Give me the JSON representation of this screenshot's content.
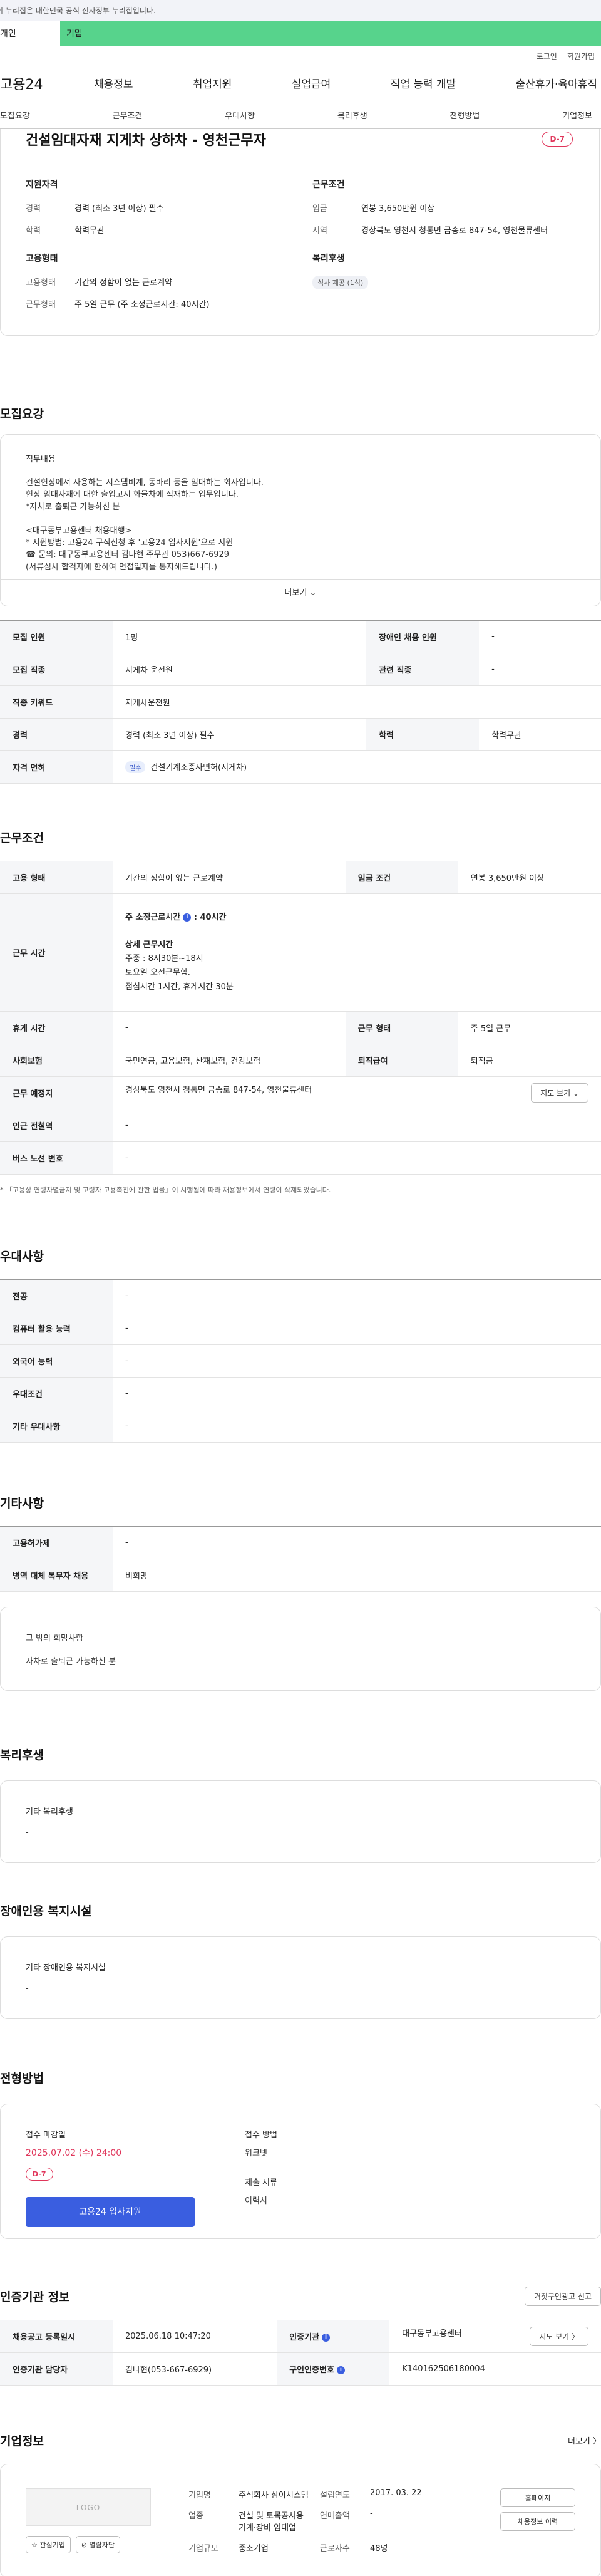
{
  "notice": "이 누리집은 대한민국 공식 전자정부 누리집입니다.",
  "top_tabs": {
    "personal": "개인",
    "company": "기업"
  },
  "util": {
    "login": "로그인",
    "join": "회원가입"
  },
  "logo": "고용24",
  "gnb": [
    "채용정보",
    "취업지원",
    "실업급여",
    "직업 능력 개발",
    "출산휴가·육아휴직"
  ],
  "anchor_nav": [
    "모집요강",
    "근무조건",
    "우대사항",
    "복리후생",
    "전형방법",
    "기업정보"
  ],
  "job": {
    "title": "건설임대자재 지게차 상하차 - 영천근무자",
    "dday": "D-7"
  },
  "summary": {
    "qual_title": "지원자격",
    "career_k": "경력",
    "career_v": "경력 (최소 3년 이상) 필수",
    "edu_k": "학력",
    "edu_v": "학력무관",
    "emp_title": "고용형태",
    "emptype_k": "고용형태",
    "emptype_v": "기간의 정함이 없는 근로계약",
    "worktype_k": "근무형태",
    "worktype_v": "주 5일 근무 (주 소정근로시간: 40시간)",
    "cond_title": "근무조건",
    "wage_k": "임금",
    "wage_v": "연봉 3,650만원 이상",
    "region_k": "지역",
    "region_v": "경상북도 영천시 청통면 금송로 847-54, 영천물류센터",
    "welfare_title": "복리후생",
    "welfare_chip": "식사 제공 (1식)"
  },
  "recruit": {
    "title": "모집요강",
    "duty_title": "직무내용",
    "duty_lines": [
      "건설현장에서 사용하는 시스템비계, 동바리 등을 임대하는 회사입니다.",
      "현장 임대자재에 대한 출입고시 화물차에 적재하는 업무입니다.",
      "*자차로 출퇴근 가능하신 분",
      "",
      "<대구동부고용센터 채용대행>",
      "* 지원방법: 고용24 구직신청 후 '고용24 입사지원'으로 지원",
      "☎ 문의: 대구동부고용센터 김나현 주무관 053)667-6929",
      "(서류심사 합격자에 한하여 면접일자를 통지해드립니다.)"
    ],
    "more": "더보기 ⌄",
    "headcount_k": "모집 인원",
    "headcount_v": "1명",
    "disabled_k": "장애인 채용 인원",
    "disabled_v": "-",
    "job_k": "모집 직종",
    "job_v": "지게차 운전원",
    "related_k": "관련 직종",
    "related_v": "-",
    "keyword_k": "직종 키워드",
    "keyword_v": "지게차운전원",
    "career_k": "경력",
    "career_v": "경력 (최소 3년 이상) 필수",
    "edu_k": "학력",
    "edu_v": "학력무관",
    "license_k": "자격 면허",
    "license_chip": "필수",
    "license_v": "건설기계조종사면허(지게차)"
  },
  "conditions": {
    "title": "근무조건",
    "emptype_k": "고용 형태",
    "emptype_v": "기간의 정함이 없는 근로계약",
    "wage_k": "임금 조건",
    "wage_v": "연봉 3,650만원 이상",
    "hours_k": "근무 시간",
    "hours_main": "주 소정근로시간",
    "hours_val": ": 40시간",
    "hours_detail_title": "상세 근무시간",
    "hours_detail_lines": [
      "주중 : 8시30분~18시",
      "토요일 오전근무함.",
      "점심시간 1시간, 휴게시간 30분"
    ],
    "rest_k": "휴게 시간",
    "rest_v": "-",
    "form_k": "근무 형태",
    "form_v": "주 5일 근무",
    "insurance_k": "사회보험",
    "insurance_v": "국민연금, 고용보험, 산재보험, 건강보험",
    "severance_k": "퇴직급여",
    "severance_v": "퇴직금",
    "place_k": "근무 예정지",
    "place_v": "경상북도 영천시 청통면 금송로 847-54, 영천물류센터",
    "map_btn": "지도 보기 ⌄",
    "subway_k": "인근 전철역",
    "subway_v": "-",
    "bus_k": "버스 노선 번호",
    "bus_v": "-",
    "note": "* 「고용상 연령차별금지 및 고령자 고용촉진에 관한 법률」이 시행됨에 따라 채용정보에서 연령이 삭제되었습니다."
  },
  "preference": {
    "title": "우대사항",
    "rows": [
      {
        "k": "전공",
        "v": "-"
      },
      {
        "k": "컴퓨터 활용 능력",
        "v": "-"
      },
      {
        "k": "외국어 능력",
        "v": "-"
      },
      {
        "k": "우대조건",
        "v": "-"
      },
      {
        "k": "기타 우대사항",
        "v": "-"
      }
    ]
  },
  "etc": {
    "title": "기타사항",
    "rows": [
      {
        "k": "고용허가제",
        "v": "-"
      },
      {
        "k": "병역 대체 복무자 채용",
        "v": "비희망"
      }
    ],
    "box_title": "그 밖의 희망사항",
    "box_text": "자차로 출퇴근 가능하신 분"
  },
  "welfare": {
    "title": "복리후생",
    "box_title": "기타 복리후생",
    "box_text": "-"
  },
  "disabled_facility": {
    "title": "장애인용 복지시설",
    "box_title": "기타 장애인용 복지시설",
    "box_text": "-"
  },
  "process": {
    "title": "전형방법",
    "deadline_title": "접수 마감일",
    "deadline": "2025.07.02 (수) 24:00",
    "dday": "D-7",
    "apply_btn": "고용24 입사지원",
    "method_title": "접수 방법",
    "method_v": "워크넷",
    "docs_title": "제출 서류",
    "docs_v": "이력서"
  },
  "cert": {
    "title": "인증기관 정보",
    "report_btn": "거짓구인광고 신고",
    "reg_k": "채용공고 등록일시",
    "reg_v": "2025.06.18 10:47:20",
    "org_k": "인증기관",
    "org_v": "대구동부고용센터",
    "map_btn": "지도 보기 〉",
    "staff_k": "인증기관 담당자",
    "staff_v": "김나현(053-667-6929)",
    "id_k": "구인인증번호",
    "id_v": "K140162506180004"
  },
  "company": {
    "title": "기업정보",
    "more": "더보기 〉",
    "logo": "LOGO",
    "interest_btn": "☆ 관심기업",
    "block_btn": "⊘ 열람차단",
    "name_k": "기업명",
    "name_v": "주식회사 삼이시스템",
    "industry_k": "업종",
    "industry_v": "건설 및 토목공사용 기계·장비 임대업",
    "size_k": "기업규모",
    "size_v": "중소기업",
    "founded_k": "설립연도",
    "founded_v": "2017. 03. 22",
    "sales_k": "연매출액",
    "sales_v": "-",
    "employees_k": "근로자수",
    "employees_v": "48명",
    "homepage_btn": "홈페이지",
    "list_btn": "채용정보 이력"
  }
}
